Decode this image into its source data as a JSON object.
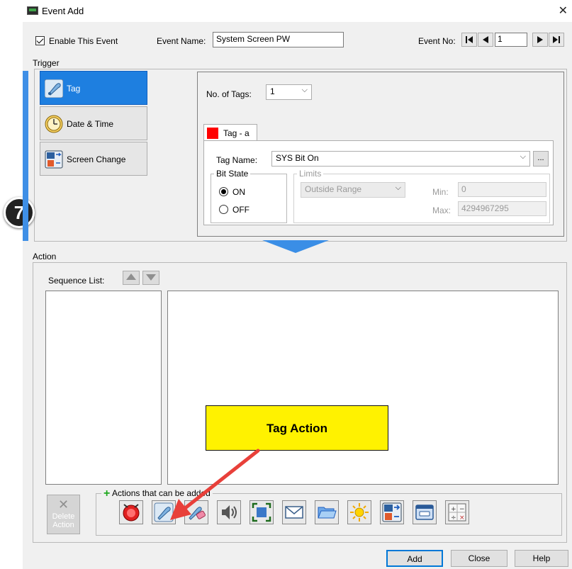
{
  "window": {
    "title": "Event Add",
    "close_glyph": "✕"
  },
  "header": {
    "enable_label": "Enable This Event",
    "enable_checked": true,
    "event_name_label": "Event Name:",
    "event_name_value": "System Screen PW",
    "event_no_label": "Event No:",
    "event_no_value": "1"
  },
  "trigger": {
    "section_label": "Trigger",
    "buttons": [
      {
        "label": "Tag",
        "icon": "tag-icon",
        "selected": true
      },
      {
        "label": "Date & Time",
        "icon": "clock-icon",
        "selected": false
      },
      {
        "label": "Screen Change",
        "icon": "screen-change-icon",
        "selected": false
      }
    ],
    "no_of_tags_label": "No. of Tags:",
    "no_of_tags_value": "1",
    "tab_label": "Tag - a",
    "tab_color": "#ff0000",
    "tag_name_label": "Tag Name:",
    "tag_name_value": "SYS Bit On",
    "browse_label": "...",
    "bit_state_label": "Bit State",
    "on_label": "ON",
    "off_label": "OFF",
    "bit_state_selected": "ON",
    "limits_label": "Limits",
    "limits_value": "Outside Range",
    "min_label": "Min:",
    "min_value": "0",
    "max_label": "Max:",
    "max_value": "4294967295"
  },
  "action": {
    "section_label": "Action",
    "sequence_list_label": "Sequence List:",
    "delete_action_label": "Delete Action",
    "actions_title": "Actions that can be added",
    "action_icons": [
      "alarm-icon",
      "tag-action-icon",
      "tag-erase-icon",
      "sound-icon",
      "screen-capture-icon",
      "mail-icon",
      "open-file-icon",
      "brightness-icon",
      "screen-change-icon",
      "window-icon",
      "calculator-icon"
    ]
  },
  "footer": {
    "add_label": "Add",
    "close_label": "Close",
    "help_label": "Help"
  },
  "annotations": {
    "step_number": "7",
    "callout_text": "Tag Action"
  },
  "colors": {
    "selection_blue": "#1e7fe0",
    "accent_blue": "#0078d7",
    "callout_yellow": "#fff200",
    "arrow_red": "#e8403a"
  }
}
